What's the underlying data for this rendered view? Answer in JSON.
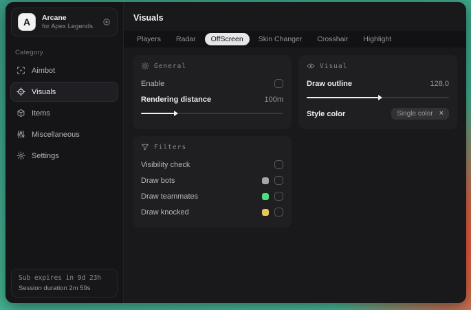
{
  "brand": {
    "logo_letter": "A",
    "name": "Arcane",
    "subtitle": "for Apex Legends"
  },
  "sidebar": {
    "category_label": "Category",
    "items": [
      {
        "label": "Aimbot"
      },
      {
        "label": "Visuals"
      },
      {
        "label": "Items"
      },
      {
        "label": "Miscellaneous"
      },
      {
        "label": "Settings"
      }
    ],
    "footer": {
      "sub_expires": "Sub expires in 9d 23h",
      "session_duration": "Session duration 2m 59s"
    }
  },
  "main": {
    "title": "Visuals",
    "selected_tab": "OffScreen",
    "tabs": [
      {
        "label": "Players"
      },
      {
        "label": "Radar"
      },
      {
        "label": "OffScreen"
      },
      {
        "label": "Skin Changer"
      },
      {
        "label": "Crosshair"
      },
      {
        "label": "Highlight"
      }
    ]
  },
  "general_panel": {
    "title": "General",
    "enable_label": "Enable",
    "rendering_label": "Rendering distance",
    "rendering_value": "100m",
    "slider_fill": "23%"
  },
  "visual_panel": {
    "title": "Visual",
    "outline_label": "Draw outline",
    "outline_value": "128.0",
    "slider_fill": "50%",
    "style_label": "Style color",
    "style_value": "Single color",
    "style_clear": "×"
  },
  "filters_panel": {
    "title": "Filters",
    "rows": [
      {
        "label": "Visibility check",
        "swatch": ""
      },
      {
        "label": "Draw bots",
        "swatch": "#a3a7ad"
      },
      {
        "label": "Draw teammates",
        "swatch": "#4ade80"
      },
      {
        "label": "Draw knocked",
        "swatch": "#e6c65a"
      }
    ]
  },
  "colors": {
    "accent_teal": "#46b795",
    "accent_red": "#ef5a3c"
  }
}
